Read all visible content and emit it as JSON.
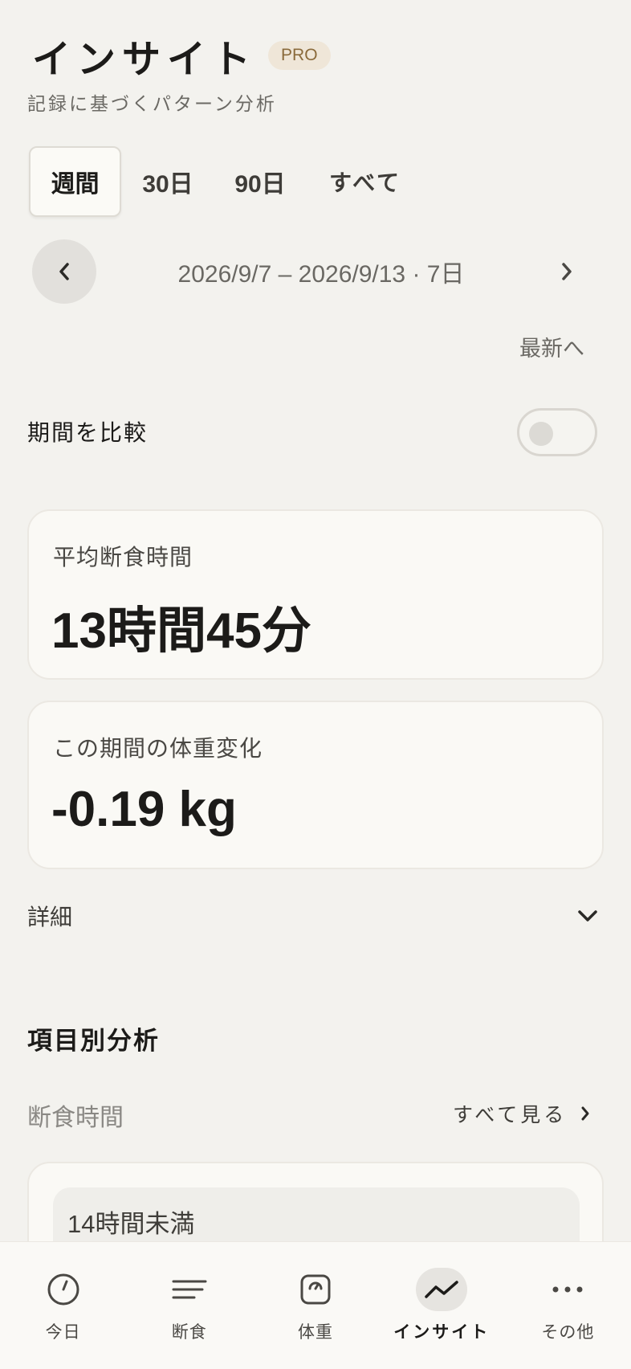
{
  "header": {
    "title": "インサイト",
    "badge": "PRO",
    "subtitle": "記録に基づくパターン分析"
  },
  "tabs": [
    {
      "label": "週間",
      "active": true
    },
    {
      "label": "30日",
      "active": false
    },
    {
      "label": "90日",
      "active": false
    },
    {
      "label": "すべて",
      "active": false
    }
  ],
  "period": {
    "range": "2026/9/7 – 2026/9/13 · 7日",
    "latest_link": "最新へ"
  },
  "compare": {
    "label": "期間を比較",
    "enabled": false
  },
  "stats": {
    "avg_fasting_label": "平均断食時間",
    "avg_fasting_value": "13時間45分",
    "weight_change_label": "この期間の体重変化",
    "weight_change_value": "-0.19 kg"
  },
  "details": {
    "label": "詳細"
  },
  "analysis": {
    "section_title": "項目別分析",
    "category_label": "断食時間",
    "see_all": "すべて見る",
    "bucket_label": "14時間未満"
  },
  "bottom_nav": [
    {
      "label": "今日",
      "icon": "clock-icon",
      "active": false
    },
    {
      "label": "断食",
      "icon": "lines-icon",
      "active": false
    },
    {
      "label": "体重",
      "icon": "scale-icon",
      "active": false
    },
    {
      "label": "インサイト",
      "icon": "trend-icon",
      "active": true
    },
    {
      "label": "その他",
      "icon": "more-icon",
      "active": false
    }
  ],
  "colors": {
    "background": "#f3f2ee",
    "card": "#faf9f5",
    "badge_bg": "#efe6d8",
    "badge_text": "#8a6a3b"
  }
}
